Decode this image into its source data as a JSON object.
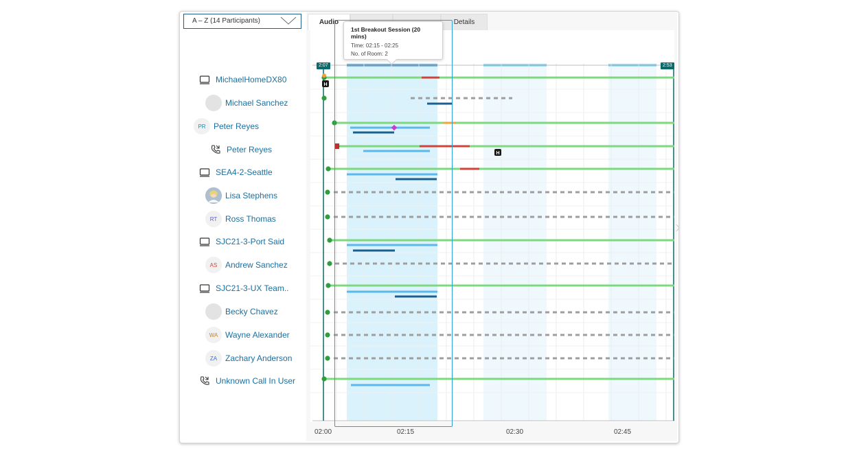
{
  "sort_dropdown": {
    "label": "A – Z (14 Participants)"
  },
  "tabs": [
    {
      "label": "Audio"
    },
    {
      "label": ""
    },
    {
      "label": ""
    },
    {
      "label": "Details"
    }
  ],
  "tooltip": {
    "title": "1st Breakout Session (20 mins)",
    "time": "Time: 02:15 - 02:25",
    "rooms": "No. of Room: 2"
  },
  "time_tags": {
    "start": "2:07",
    "end": "2:53"
  },
  "axis_labels": [
    "02:00",
    "02:15",
    "02:30",
    "02:45"
  ],
  "participants": [
    {
      "name": "MichaelHomeDX80",
      "kind": "device",
      "icon": "device-icon"
    },
    {
      "name": "Michael Sanchez",
      "kind": "avatar",
      "initials": ""
    },
    {
      "name": "Peter Reyes",
      "kind": "avatar",
      "initials": "PR"
    },
    {
      "name": "Peter Reyes",
      "kind": "phone",
      "icon": "phone-call-icon"
    },
    {
      "name": "SEA4-2-Seattle",
      "kind": "device",
      "icon": "device-icon"
    },
    {
      "name": "Lisa Stephens",
      "kind": "photo",
      "initials": ""
    },
    {
      "name": "Ross Thomas",
      "kind": "avatar",
      "initials": "RT"
    },
    {
      "name": "SJC21-3-Port Said",
      "kind": "device",
      "icon": "device-icon"
    },
    {
      "name": "Andrew Sanchez",
      "kind": "avatar",
      "initials": "AS"
    },
    {
      "name": "SJC21-3-UX Team..",
      "kind": "device",
      "icon": "device-icon"
    },
    {
      "name": "Becky Chavez",
      "kind": "avatar",
      "initials": ""
    },
    {
      "name": "Wayne Alexander",
      "kind": "avatar",
      "initials": "WA"
    },
    {
      "name": "Zachary Anderson",
      "kind": "avatar",
      "initials": "ZA"
    },
    {
      "name": "Unknown Call In User",
      "kind": "phone",
      "icon": "phone-call-icon"
    }
  ],
  "host_badge": "H",
  "colors": {
    "accent": "#1b6fa0",
    "audio_line": "#7ed87e",
    "audio_dot": "#2e9e3e",
    "video_light": "#5bb8ec",
    "video_dark": "#1c5f8f",
    "issue_red": "#d0433a",
    "issue_orange": "#f0a33a",
    "dashed_gray": "#9e9e9e",
    "breakout_bg": "#d9f2fb",
    "tag_bg": "#0b6a6a"
  }
}
